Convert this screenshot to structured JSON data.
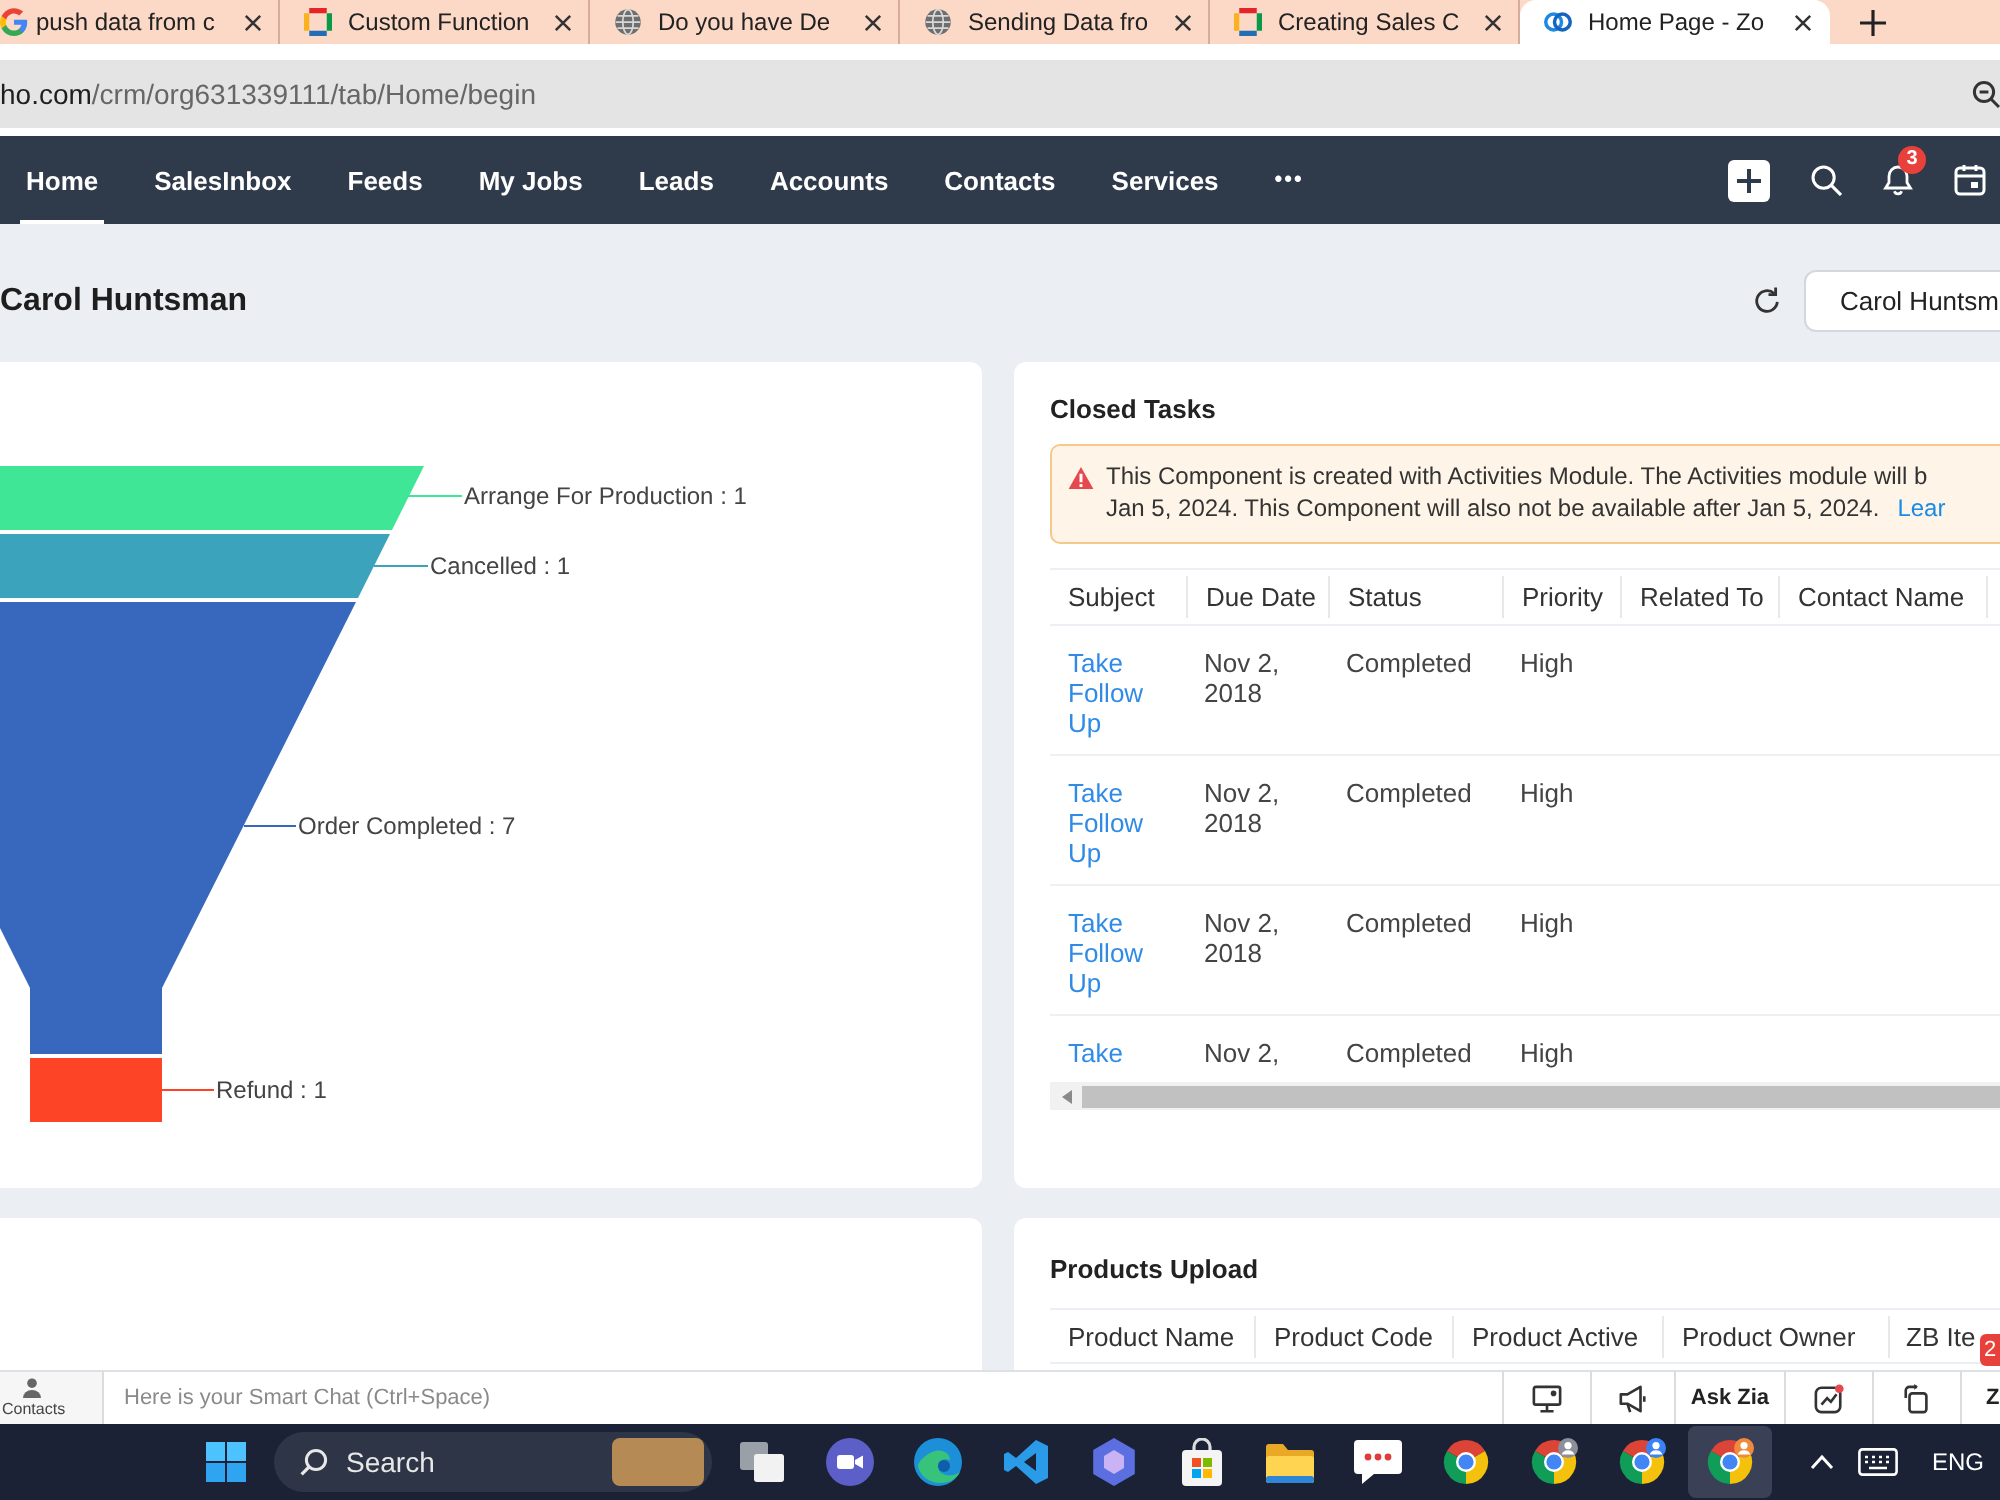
{
  "browser": {
    "tabs": [
      {
        "title": "push data from c",
        "kind": "google",
        "selected": false
      },
      {
        "title": "Custom Function",
        "kind": "zoho",
        "selected": false
      },
      {
        "title": "Do you have De",
        "kind": "globe",
        "selected": false
      },
      {
        "title": "Sending Data fro",
        "kind": "globe",
        "selected": false
      },
      {
        "title": "Creating Sales C",
        "kind": "zoho",
        "selected": false
      },
      {
        "title": "Home Page - Zo",
        "kind": "crm",
        "selected": true
      }
    ],
    "address": {
      "host": "ho.com",
      "path": "/crm/org631339111/tab/Home/begin"
    }
  },
  "nav": {
    "items": [
      {
        "label": "Home",
        "selected": true
      },
      {
        "label": "SalesInbox",
        "selected": false
      },
      {
        "label": "Feeds",
        "selected": false
      },
      {
        "label": "My Jobs",
        "selected": false
      },
      {
        "label": "Leads",
        "selected": false
      },
      {
        "label": "Accounts",
        "selected": false
      },
      {
        "label": "Contacts",
        "selected": false
      },
      {
        "label": "Services",
        "selected": false
      }
    ],
    "more": "•••",
    "notification_count": "3"
  },
  "header": {
    "title": "Carol Huntsman",
    "user_button": "Carol Huntsm"
  },
  "funnel": {
    "stages": [
      {
        "label": "Arrange For Production : 1",
        "color": "#3ee696"
      },
      {
        "label": "Cancelled : 1",
        "color": "#3ba3bc"
      },
      {
        "label": "Order Completed : 7",
        "color": "#3768bd"
      },
      {
        "label": "Refund : 1",
        "color": "#fd4426"
      }
    ]
  },
  "closed_tasks": {
    "title": "Closed Tasks",
    "alert": {
      "lines": [
        "This Component is created with Activities Module. The Activities module will b",
        "Jan 5, 2024. This Component will also not be available after Jan 5, 2024."
      ],
      "link": "Lear"
    },
    "columns": [
      "Subject",
      "Due Date",
      "Status",
      "Priority",
      "Related To",
      "Contact Name"
    ],
    "rows": [
      {
        "subject": "Take Follow Up",
        "due_date": "Nov 2, 2018",
        "status": "Completed",
        "priority": "High"
      },
      {
        "subject": "Take Follow Up",
        "due_date": "Nov 2, 2018",
        "status": "Completed",
        "priority": "High"
      },
      {
        "subject": "Take Follow Up",
        "due_date": "Nov 2, 2018",
        "status": "Completed",
        "priority": "High"
      },
      {
        "subject": "Take",
        "due_date": "Nov 2,",
        "status": "Completed",
        "priority": "High"
      }
    ]
  },
  "products_upload": {
    "title": "Products Upload",
    "columns": [
      "Product Name",
      "Product Code",
      "Product Active",
      "Product Owner",
      "ZB Ite"
    ]
  },
  "smart_chat": {
    "contacts_label": "Contacts",
    "placeholder": "Here is your Smart Chat (Ctrl+Space)",
    "ask_zia": "Ask Zia",
    "next_label": "Z",
    "badge": "2"
  },
  "taskbar": {
    "search_label": "Search",
    "language": "ENG"
  }
}
